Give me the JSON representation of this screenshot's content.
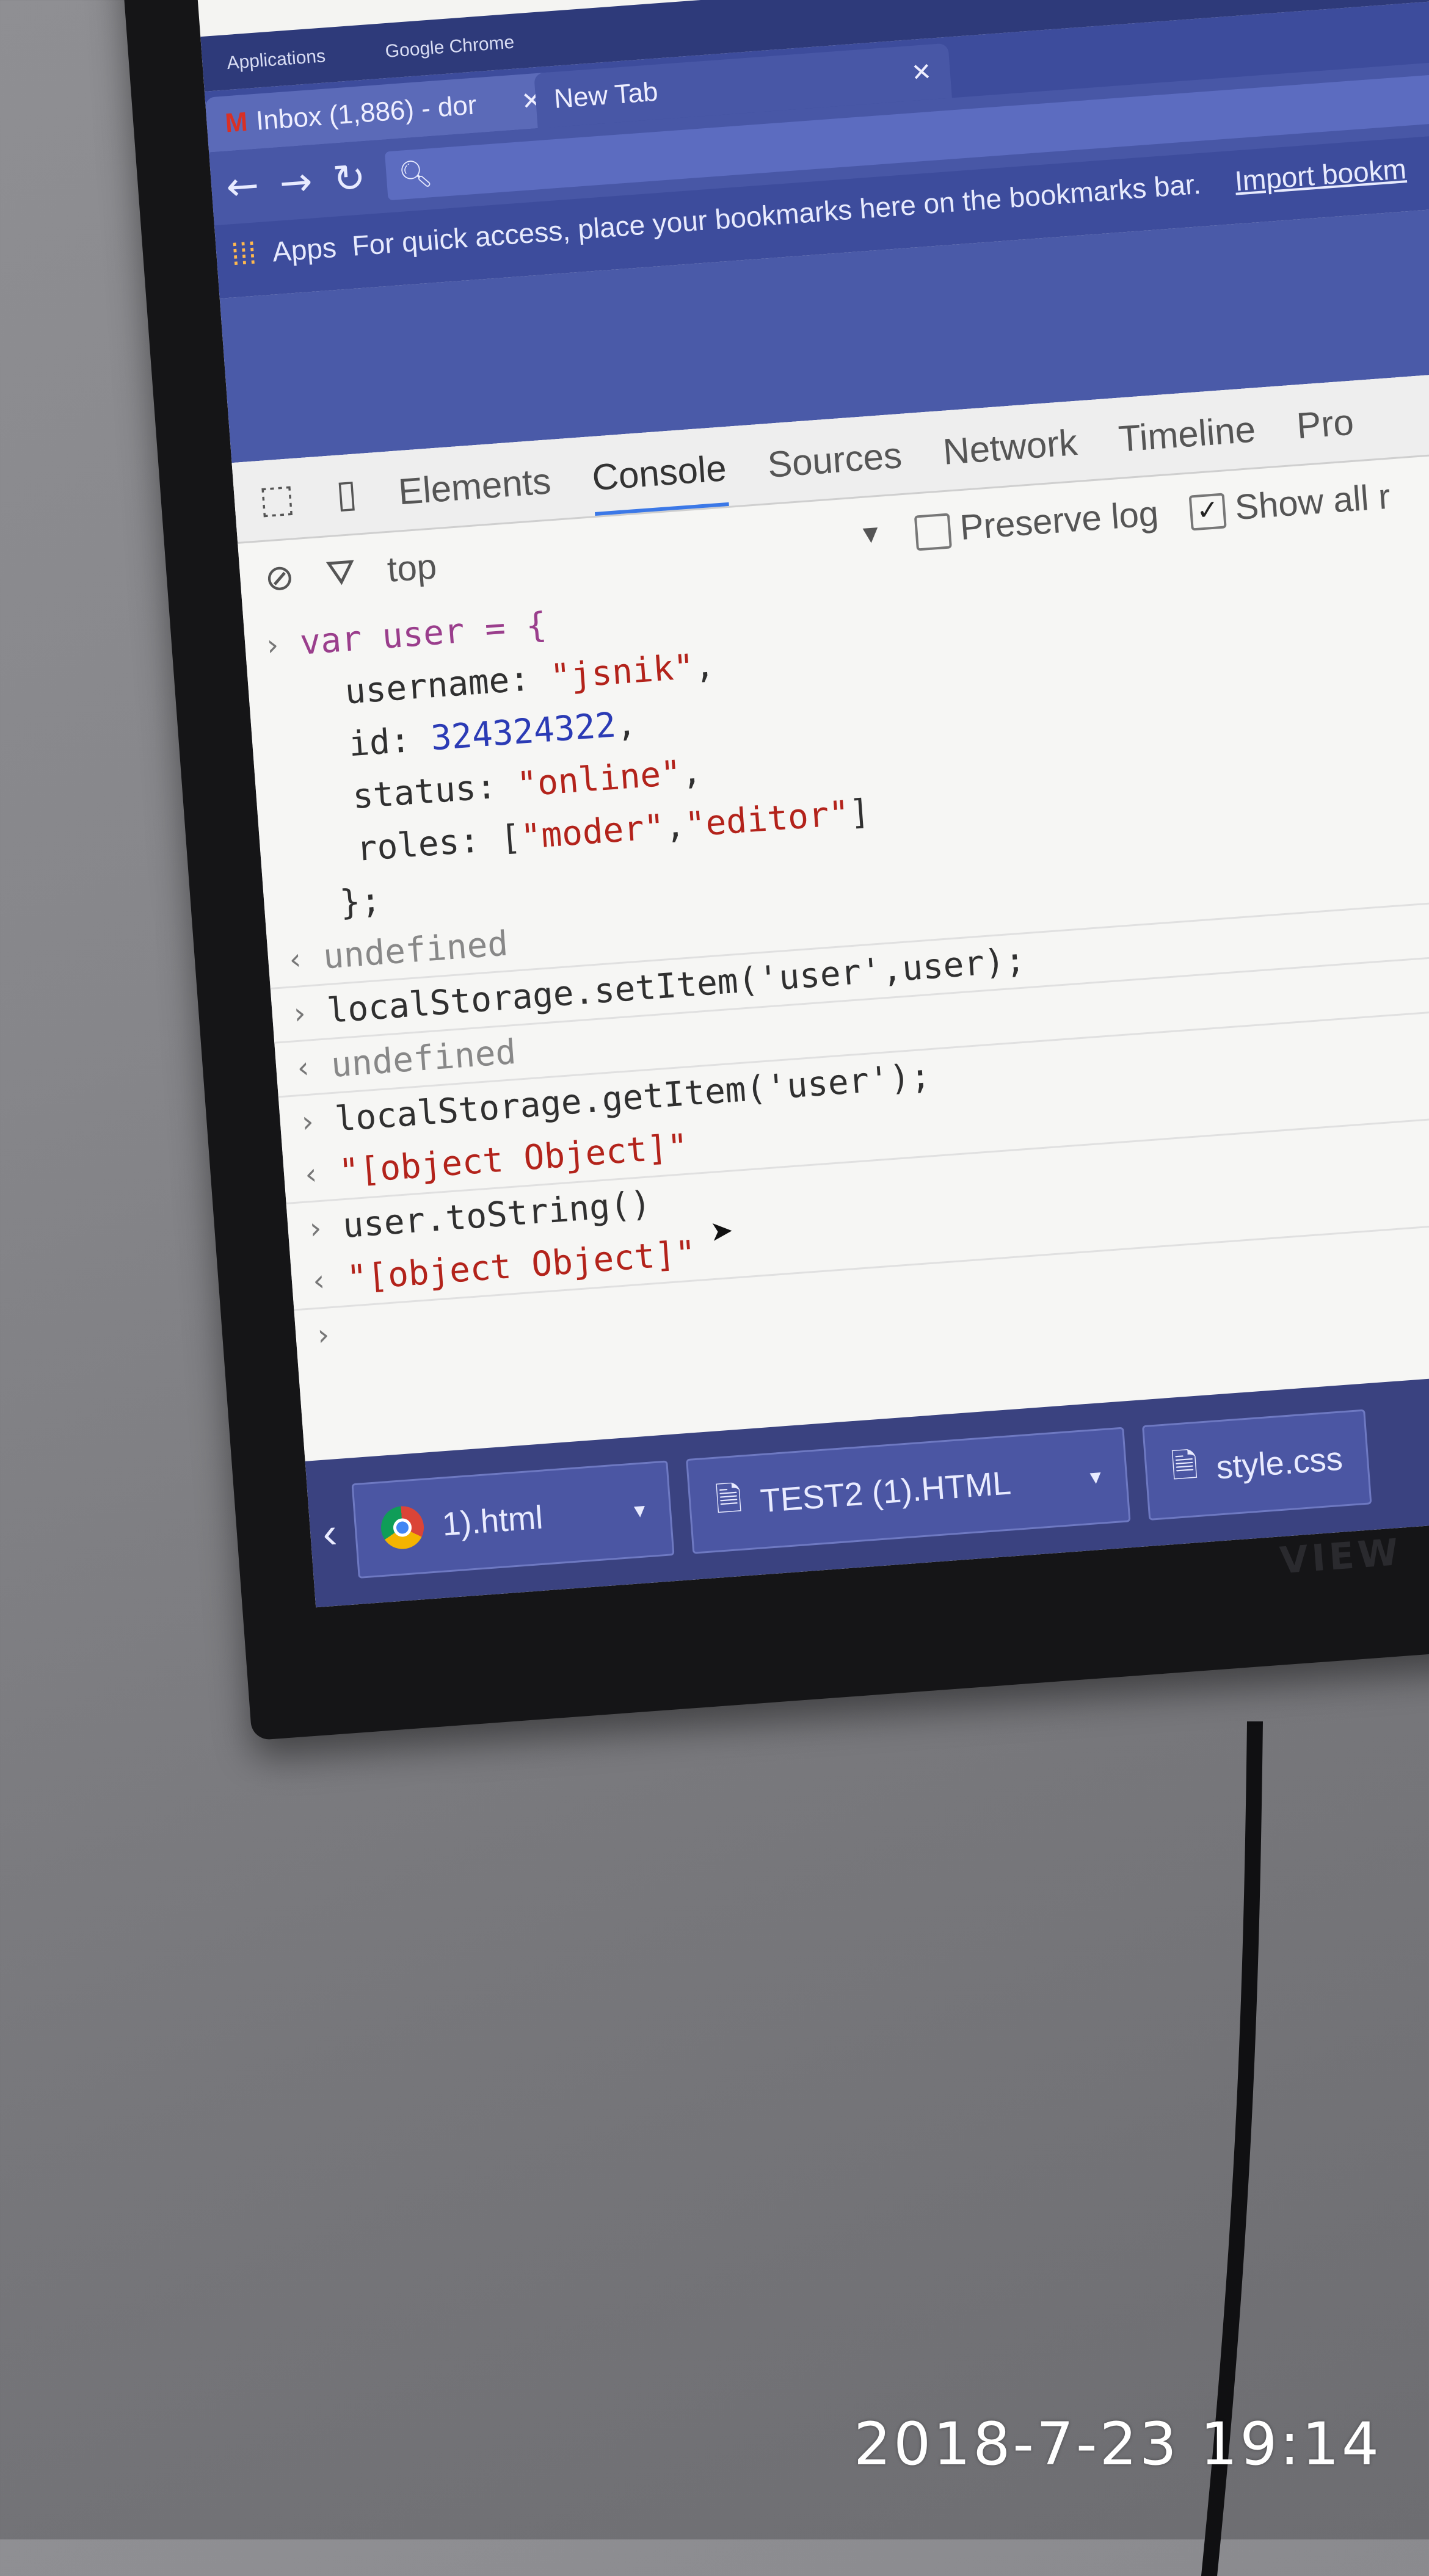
{
  "desktop_panel": {
    "applications": "Applications",
    "window_title": "Google Chrome"
  },
  "browser": {
    "tabs": [
      {
        "label": "Inbox (1,886) - dor"
      },
      {
        "label": "New Tab"
      }
    ],
    "bookmarks_bar": {
      "apps": "Apps",
      "hint": "For quick access, place your bookmarks here on the bookmarks bar.",
      "import_link": "Import bookm"
    }
  },
  "devtools": {
    "tabs": [
      "Elements",
      "Console",
      "Sources",
      "Network",
      "Timeline",
      "Pro"
    ],
    "active_tab": "Console",
    "context": "top",
    "preserve_log": "Preserve log",
    "show_all": "Show all r",
    "preserve_log_checked": false,
    "show_all_checked": true
  },
  "console": {
    "var_decl": "var user = {",
    "prop_username_key": "username: ",
    "prop_username_val": "\"jsnik\"",
    "prop_id_key": "id: ",
    "prop_id_val": "324324322",
    "prop_status_key": "status: ",
    "prop_status_val": "\"online\"",
    "prop_roles_key": "roles: [",
    "prop_roles_val1": "\"moder\"",
    "prop_roles_val2": "\"editor\"",
    "close_brace": "};",
    "result1": "undefined",
    "cmd_set": "localStorage.setItem('user',user);",
    "result2": "undefined",
    "cmd_get": "localStorage.getItem('user');",
    "result3": "\"[object Object]\"",
    "cmd_tostring": "user.toString()",
    "result4": "\"[object Object]\""
  },
  "taskbar": {
    "items": [
      "1).html",
      "TEST2 (1).HTML",
      "style.css"
    ]
  },
  "timestamp": "2018-7-23 19:14",
  "colors": {
    "chrome_frame": "#3d4c9c",
    "devtools_active": "#3b78e7",
    "string_red": "#b3231b",
    "number_blue": "#2b3bb5"
  }
}
